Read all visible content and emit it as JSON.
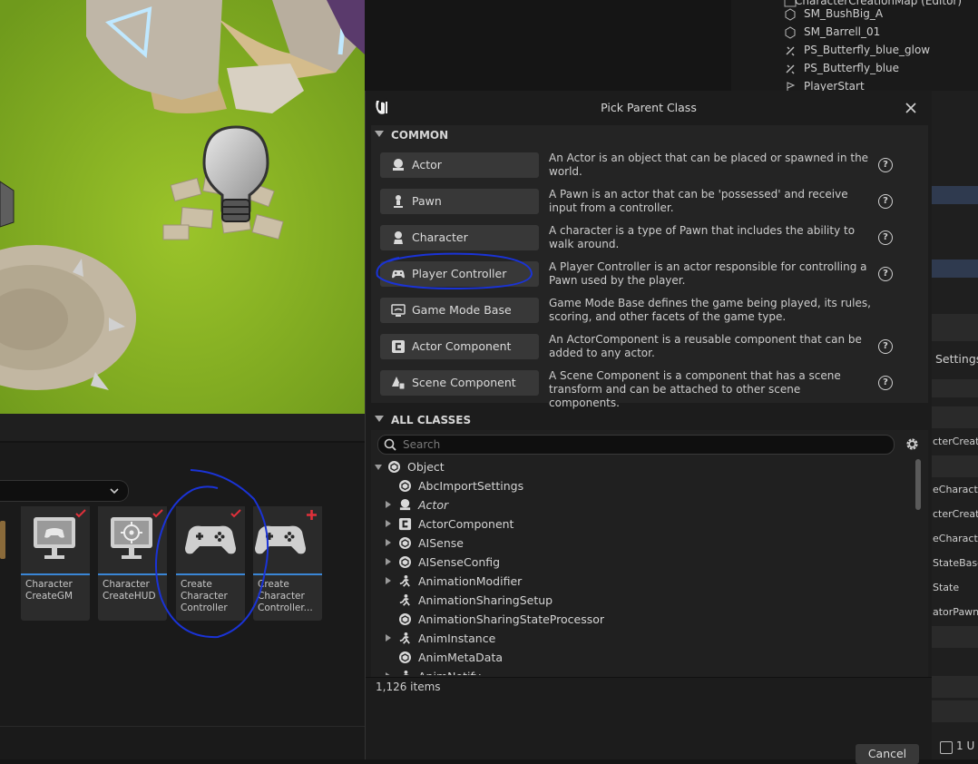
{
  "outliner": {
    "partial_title": "CharacterCreationMap (Editor)",
    "items": [
      "SM_BushBig_A",
      "SM_Barrell_01",
      "PS_Butterfly_blue_glow",
      "PS_Butterfly_blue",
      "PlayerStart"
    ]
  },
  "right_panel": {
    "settings_label": "Settings",
    "rows": [
      "cterCreate",
      "eCharacter",
      "cterCreate",
      "eCharacter",
      "StateBase",
      "State",
      "atorPawn"
    ],
    "bottom_label": "1 U"
  },
  "content_browser": {
    "assets": [
      {
        "label": "Character CreateGM",
        "checked": true
      },
      {
        "label": "Character CreateHUD",
        "checked": true
      },
      {
        "label": "Create Character Controller",
        "checked": true
      },
      {
        "label": "Create Character Controller...",
        "checked": false,
        "new": true
      }
    ]
  },
  "dialog": {
    "title": "Pick Parent Class",
    "common_header": "COMMON",
    "common_classes": [
      {
        "name": "Actor",
        "icon": "actor-icon",
        "description": "An Actor is an object that can be placed or spawned in the world.",
        "help": true
      },
      {
        "name": "Pawn",
        "icon": "pawn-icon",
        "description": "A Pawn is an actor that can be 'possessed' and receive input from a controller.",
        "help": true
      },
      {
        "name": "Character",
        "icon": "character-icon",
        "description": "A character is a type of Pawn that includes the ability to walk around.",
        "help": true
      },
      {
        "name": "Player Controller",
        "icon": "gamepad-icon",
        "description": "A Player Controller is an actor responsible for controlling a Pawn used by the player.",
        "help": true
      },
      {
        "name": "Game Mode Base",
        "icon": "game-mode-icon",
        "description": "Game Mode Base defines the game being played, its rules, scoring, and other facets of the game type.",
        "help": false
      },
      {
        "name": "Actor Component",
        "icon": "actor-component-icon",
        "description": "An ActorComponent is a reusable component that can be added to any actor.",
        "help": true
      },
      {
        "name": "Scene Component",
        "icon": "scene-component-icon",
        "description": "A Scene Component is a component that has a scene transform and can be attached to other scene components.",
        "help": true
      }
    ],
    "all_classes_header": "ALL CLASSES",
    "search_placeholder": "Search",
    "tree": [
      {
        "name": "Object",
        "indent": 0,
        "expandable": true,
        "expanded": true,
        "italic": false
      },
      {
        "name": "AbcImportSettings",
        "indent": 1,
        "expandable": false,
        "italic": false
      },
      {
        "name": "Actor",
        "indent": 1,
        "expandable": true,
        "italic": true
      },
      {
        "name": "ActorComponent",
        "indent": 1,
        "expandable": true,
        "italic": false
      },
      {
        "name": "AISense",
        "indent": 1,
        "expandable": true,
        "italic": false
      },
      {
        "name": "AISenseConfig",
        "indent": 1,
        "expandable": true,
        "italic": false
      },
      {
        "name": "AnimationModifier",
        "indent": 1,
        "expandable": true,
        "italic": false
      },
      {
        "name": "AnimationSharingSetup",
        "indent": 1,
        "expandable": false,
        "italic": false
      },
      {
        "name": "AnimationSharingStateProcessor",
        "indent": 1,
        "expandable": false,
        "italic": false
      },
      {
        "name": "AnimInstance",
        "indent": 1,
        "expandable": true,
        "italic": false
      },
      {
        "name": "AnimMetaData",
        "indent": 1,
        "expandable": false,
        "italic": false
      },
      {
        "name": "AnimNotify",
        "indent": 1,
        "expandable": true,
        "italic": false
      }
    ],
    "item_count": "1,126 items",
    "cancel_label": "Cancel"
  },
  "colors": {
    "accent_blue": "#3a86d6",
    "annotation_ink": "#1a33d6",
    "check_red": "#e0303a",
    "dialog_bg": "#1c1c1c",
    "button_bg": "#383838"
  }
}
